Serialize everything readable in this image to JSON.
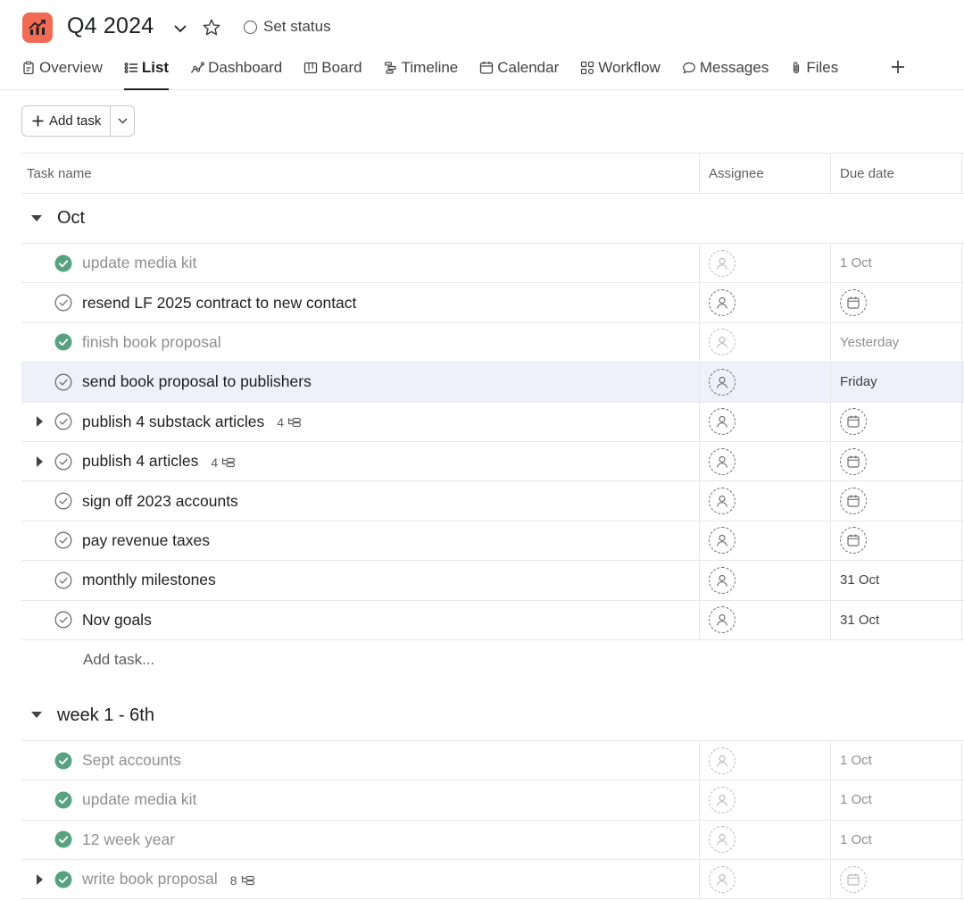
{
  "project": {
    "title": "Q4 2024",
    "icon": "trend-chart-icon",
    "brand_color": "#f06a54",
    "set_status_label": "Set status"
  },
  "tabs": [
    {
      "label": "Overview",
      "icon": "clipboard-icon"
    },
    {
      "label": "List",
      "icon": "list-icon",
      "active": true
    },
    {
      "label": "Dashboard",
      "icon": "dashboard-icon"
    },
    {
      "label": "Board",
      "icon": "board-icon"
    },
    {
      "label": "Timeline",
      "icon": "timeline-icon"
    },
    {
      "label": "Calendar",
      "icon": "calendar-icon"
    },
    {
      "label": "Workflow",
      "icon": "workflow-icon"
    },
    {
      "label": "Messages",
      "icon": "message-icon"
    },
    {
      "label": "Files",
      "icon": "paperclip-icon"
    }
  ],
  "toolbar": {
    "add_task_label": "Add task"
  },
  "columns": {
    "name": "Task name",
    "assignee": "Assignee",
    "due": "Due date"
  },
  "sections": [
    {
      "title": "Oct",
      "add_task_label": "Add task...",
      "tasks": [
        {
          "title": "update media kit",
          "done": true,
          "due": "1 Oct"
        },
        {
          "title": "resend LF 2025 contract to new contact",
          "done": false,
          "due": ""
        },
        {
          "title": "finish book proposal",
          "done": true,
          "due": "Yesterday"
        },
        {
          "title": "send book proposal to publishers",
          "done": false,
          "due": "Friday",
          "highlight": true
        },
        {
          "title": "publish 4 substack articles",
          "done": false,
          "due": "",
          "subtasks": "4",
          "expandable": true
        },
        {
          "title": "publish 4 articles",
          "done": false,
          "due": "",
          "subtasks": "4",
          "expandable": true
        },
        {
          "title": "sign off 2023 accounts",
          "done": false,
          "due": ""
        },
        {
          "title": "pay revenue taxes",
          "done": false,
          "due": ""
        },
        {
          "title": "monthly milestones",
          "done": false,
          "due": "31 Oct"
        },
        {
          "title": "Nov goals",
          "done": false,
          "due": "31 Oct"
        }
      ]
    },
    {
      "title": "week 1 - 6th",
      "tasks": [
        {
          "title": "Sept accounts",
          "done": true,
          "due": "1 Oct"
        },
        {
          "title": "update media kit",
          "done": true,
          "due": "1 Oct"
        },
        {
          "title": "12 week year",
          "done": true,
          "due": "1 Oct"
        },
        {
          "title": "write book proposal",
          "done": true,
          "due": "",
          "subtasks": "8",
          "expandable": true
        }
      ]
    }
  ],
  "colors": {
    "complete_green": "#58a182",
    "highlight_row": "#eef0fa"
  }
}
